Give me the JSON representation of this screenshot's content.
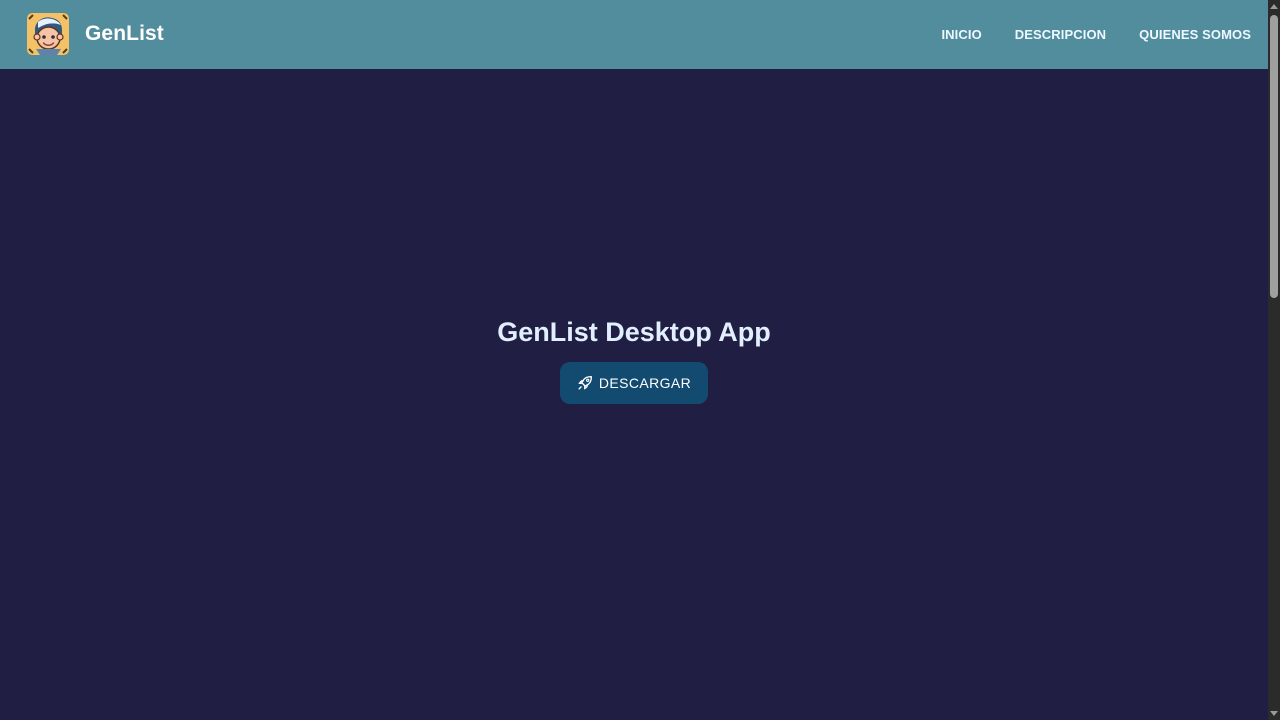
{
  "header": {
    "brand_name": "GenList",
    "logo_icon": "cartoon-face-logo-icon",
    "nav": [
      {
        "label": "INICIO"
      },
      {
        "label": "DESCRIPCION"
      },
      {
        "label": "QUIENES SOMOS"
      }
    ]
  },
  "hero": {
    "title": "GenList Desktop App",
    "download_button": {
      "label": "DESCARGAR",
      "icon": "rocket-icon"
    }
  },
  "colors": {
    "header_background": "#528d9e",
    "page_background": "#201e43",
    "button_background": "#134b70",
    "title_text": "#e2efff"
  }
}
